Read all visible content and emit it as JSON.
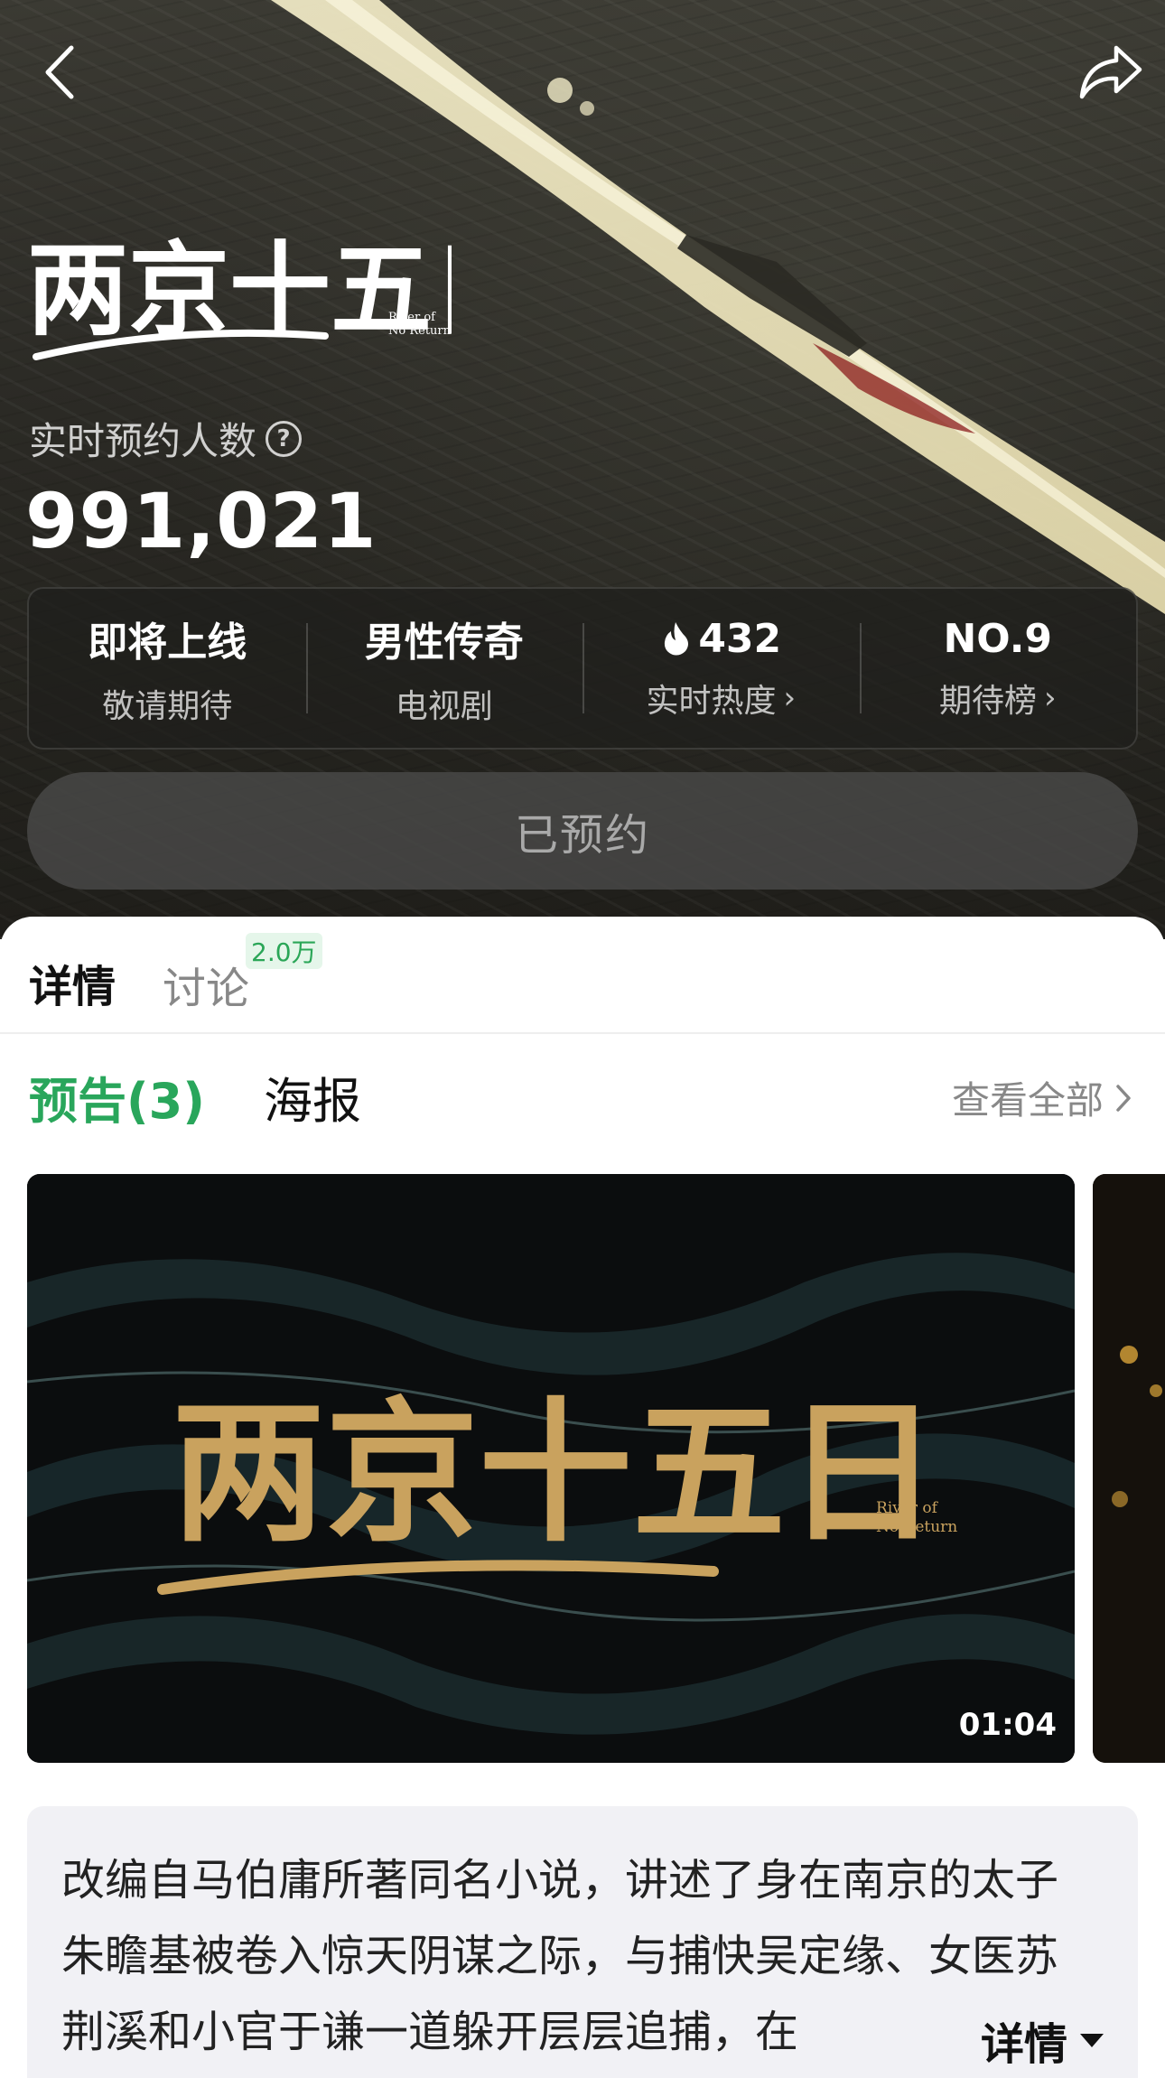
{
  "header": {
    "back_icon": "arrow-left-icon",
    "share_icon": "share-icon",
    "title_logo_text": "两京十五日",
    "title_logo_en": "River of No Return"
  },
  "reservation": {
    "label": "实时预约人数",
    "count": "991,021",
    "button_label": "已预约"
  },
  "stats": [
    {
      "top": "即将上线",
      "bottom": "敬请期待"
    },
    {
      "top": "男性传奇",
      "bottom": "电视剧"
    },
    {
      "top": "432",
      "bottom": "实时热度",
      "icon": "flame-icon"
    },
    {
      "top": "NO.9",
      "bottom": "期待榜"
    }
  ],
  "tabs": {
    "detail": "详情",
    "discuss": "讨论",
    "discuss_badge": "2.0万"
  },
  "media": {
    "trailer_tab": "预告(3)",
    "poster_tab": "海报",
    "view_all": "查看全部",
    "video_duration": "01:04"
  },
  "synopsis": {
    "text": "改编自马伯庸所著同名小说，讲述了身在南京的太子朱瞻基被卷入惊天阴谋之际，与捕快吴定缘、女医苏荆溪和小官于谦一道躲开层层追捕，在",
    "more_label": "详情"
  },
  "colors": {
    "accent_green": "#29a65b",
    "badge_bg": "#e5f6ea",
    "hero_bg": "#2c2b26"
  }
}
